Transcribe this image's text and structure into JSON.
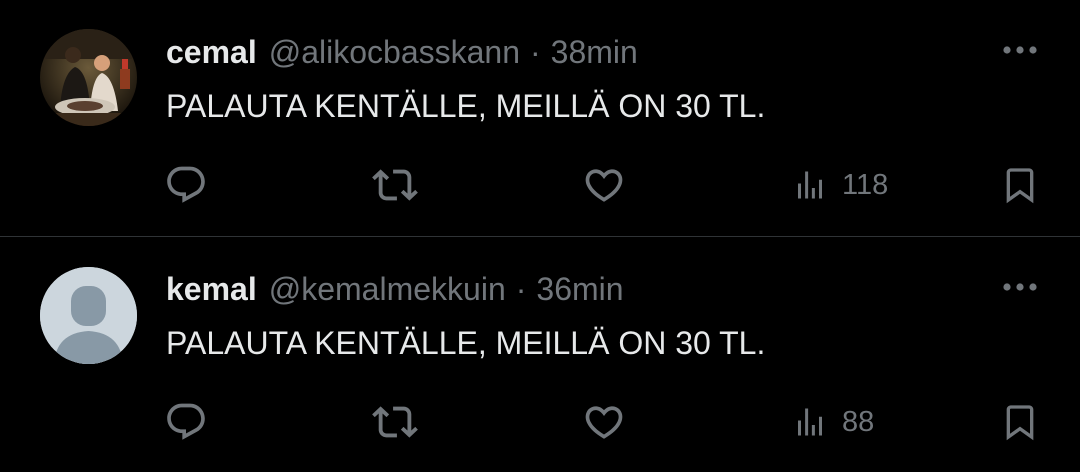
{
  "tweets": [
    {
      "name": "cemal",
      "handle": "@alikocbasskann",
      "separator": "·",
      "time": "38min",
      "text": "PALAUTA KENTÄLLE, MEILLÄ ON 30 TL.",
      "views": "118",
      "avatar": "photo-avatar"
    },
    {
      "name": "kemal",
      "handle": "@kemalmekkuin",
      "separator": "·",
      "time": "36min",
      "text": "PALAUTA KENTÄLLE, MEILLÄ ON 30 TL.",
      "views": "88",
      "avatar": "default-avatar"
    }
  ],
  "icons": {
    "reply": "reply-icon",
    "retweet": "retweet-icon",
    "like": "heart-icon",
    "views": "views-icon",
    "bookmark": "bookmark-icon",
    "more": "more-icon"
  },
  "colors": {
    "background": "#000000",
    "text": "#e7e9ea",
    "muted": "#71767b",
    "divider": "#2f3336",
    "default_avatar_bg": "#ccd6dd",
    "default_avatar_fg": "#8899a6"
  }
}
